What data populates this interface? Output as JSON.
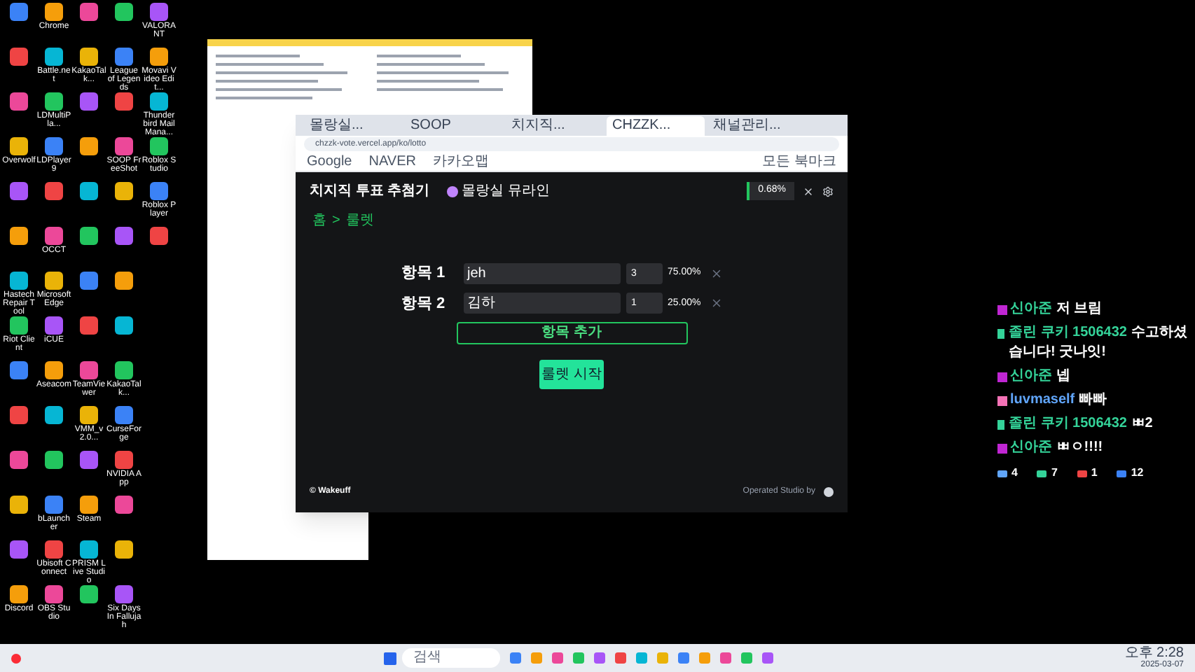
{
  "desktop_icons": [
    [
      {
        "kind": "plain"
      },
      {
        "kind": "labeled",
        "label": "Chrome"
      },
      {
        "kind": "plain"
      },
      {
        "kind": "plain"
      },
      {
        "kind": "labeled",
        "label": "VALORANT"
      }
    ],
    [
      {
        "kind": "plain"
      },
      {
        "kind": "labeled",
        "label": "Battle.net"
      },
      {
        "kind": "labeled",
        "label": "KakaoTalk..."
      },
      {
        "kind": "labeled",
        "label": "League of Legends"
      },
      {
        "kind": "labeled",
        "label": "Movavi Video Edit..."
      }
    ],
    [
      {
        "kind": "plain"
      },
      {
        "kind": "labeled",
        "label": "LDMultiPla..."
      },
      {
        "kind": "plain"
      },
      {
        "kind": "plain"
      },
      {
        "kind": "labeled",
        "label": "Thunderbird Mail Mana..."
      }
    ],
    [
      {
        "kind": "labeled",
        "label": "Overwolf"
      },
      {
        "kind": "labeled",
        "label": "LDPlayer9"
      },
      {
        "kind": "plain"
      },
      {
        "kind": "labeled",
        "label": "SOOP FreeShot"
      },
      {
        "kind": "labeled",
        "label": "Roblox Studio"
      }
    ],
    [
      {
        "kind": "plain"
      },
      {
        "kind": "plain"
      },
      {
        "kind": "plain"
      },
      {
        "kind": "plain"
      },
      {
        "kind": "labeled",
        "label": "Roblox Player"
      }
    ],
    [
      {
        "kind": "plain"
      },
      {
        "kind": "labeled",
        "label": "OCCT"
      },
      {
        "kind": "plain"
      },
      {
        "kind": "plain"
      },
      {
        "kind": "plain"
      }
    ],
    [
      {
        "kind": "labeled",
        "label": "Hastech Repair Tool"
      },
      {
        "kind": "labeled",
        "label": "Microsoft Edge"
      },
      {
        "kind": "plain"
      },
      {
        "kind": "plain"
      }
    ],
    [
      {
        "kind": "labeled",
        "label": "Riot Client"
      },
      {
        "kind": "labeled",
        "label": "iCUE"
      },
      {
        "kind": "plain"
      },
      {
        "kind": "plain"
      }
    ],
    [
      {
        "kind": "plain"
      },
      {
        "kind": "labeled",
        "label": "Aseacom"
      },
      {
        "kind": "labeled",
        "label": "TeamViewer"
      },
      {
        "kind": "labeled",
        "label": "KakaoTalk..."
      }
    ],
    [
      {
        "kind": "plain"
      },
      {
        "kind": "plain"
      },
      {
        "kind": "labeled",
        "label": "VMM_v2.0..."
      },
      {
        "kind": "labeled",
        "label": "CurseForge"
      }
    ],
    [
      {
        "kind": "plain"
      },
      {
        "kind": "plain"
      },
      {
        "kind": "plain"
      },
      {
        "kind": "labeled",
        "label": "NVIDIA App"
      }
    ],
    [
      {
        "kind": "plain"
      },
      {
        "kind": "labeled",
        "label": "bLauncher"
      },
      {
        "kind": "labeled",
        "label": "Steam"
      },
      {
        "kind": "plain"
      }
    ],
    [
      {
        "kind": "plain"
      },
      {
        "kind": "labeled",
        "label": "Ubisoft Connect"
      },
      {
        "kind": "labeled",
        "label": "PRISM Live Studio"
      },
      {
        "kind": "plain"
      }
    ],
    [
      {
        "kind": "labeled",
        "label": "Discord"
      },
      {
        "kind": "labeled",
        "label": "OBS Studio"
      },
      {
        "kind": "plain"
      },
      {
        "kind": "labeled",
        "label": "Six Days In Fallujah"
      }
    ]
  ],
  "browser": {
    "tabs": [
      {
        "label": "몰랑실...",
        "selected": false
      },
      {
        "label": "SOOP",
        "selected": false
      },
      {
        "label": "치지직...",
        "selected": false
      },
      {
        "label": "CHZZK...",
        "selected": true
      },
      {
        "label": "채널관리...",
        "selected": false
      }
    ],
    "url": "chzzk-vote.vercel.app/ko/lotto",
    "bookmarks": [
      "Google",
      "NAVER",
      "카카오맵"
    ],
    "bookmarks_folder": "모든 북마크",
    "app": {
      "title": "치지직 투표 추첨기",
      "channel": "몰랑실 뮤라인",
      "stat": "0.68%",
      "breadcrumb": [
        "홈",
        ">",
        "룰렛"
      ],
      "items": [
        {
          "label": "항목 1",
          "name": "jeh",
          "count": "3",
          "percent": "75.00%"
        },
        {
          "label": "항목 2",
          "name": "김하",
          "count": "1",
          "percent": "25.00%"
        }
      ],
      "add_button": "항목 추가",
      "start_button": "룰렛 시작",
      "footer_brand": "© Wakeuff",
      "footer_credit": "Operated Studio by"
    }
  },
  "chat": {
    "messages": [
      {
        "kind": "sub",
        "user": "신아준",
        "text": "저 브림"
      },
      {
        "kind": "fan",
        "user": "졸린 쿠키 1506432",
        "text": "수고하셨습니다! 굿나잇!"
      },
      {
        "kind": "sub",
        "user": "신아준",
        "text": "넵"
      },
      {
        "kind": "viewer",
        "user": "luvmaself",
        "text": "빠빠"
      },
      {
        "kind": "fan",
        "user": "졸린 쿠키 1506432",
        "text": "ㅃ2"
      },
      {
        "kind": "sub",
        "user": "신아준",
        "text": "ㅃㅇ!!!!"
      }
    ],
    "counts": [
      "4",
      "7",
      "1",
      "12"
    ]
  },
  "taskbar": {
    "search": "검색",
    "time": "오후 2:28",
    "date": "2025-03-07"
  }
}
